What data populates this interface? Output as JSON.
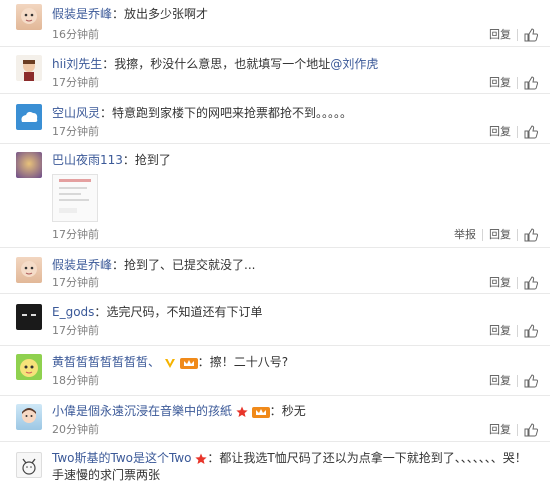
{
  "comments": [
    {
      "user": "假装是乔峰",
      "sep": "：",
      "text": "放出多少张啊才",
      "time": "16分钟前",
      "reply": "回复"
    },
    {
      "user": "hii刘先生",
      "sep": "：",
      "text": "我擦，秒没什么意思，也就填写一个地址",
      "mention": "@刘作虎",
      "time": "17分钟前",
      "reply": "回复"
    },
    {
      "user": "空山风灵",
      "sep": "：",
      "text": "特意跑到家楼下的网吧来抢票都抢不到。。。。。",
      "time": "17分钟前",
      "reply": "回复"
    },
    {
      "user": "巴山夜雨113",
      "sep": "：",
      "text": "抢到了",
      "time": "17分钟前",
      "report": "举报",
      "reply": "回复"
    },
    {
      "user": "假装是乔峰",
      "sep": "：",
      "text": "抢到了、已提交就没了...",
      "time": "17分钟前",
      "reply": "回复"
    },
    {
      "user": "E_gods",
      "sep": "：",
      "text": "选完尺码，不知道还有下订单",
      "time": "17分钟前",
      "reply": "回复"
    },
    {
      "user": "黄皙皙皙皙皙皙皙、",
      "sep": "：",
      "text": "擦！二十八号?",
      "time": "18分钟前",
      "reply": "回复"
    },
    {
      "user": "小偉是個永遠沉浸在音樂中的孩紙",
      "sep": "：",
      "text": "秒无",
      "time": "20分钟前",
      "reply": "回复"
    },
    {
      "user": "Two斯基的Two是这个Two",
      "sep": "：",
      "text": "都让我选T恤尺码了还以为点拿一下就抢到了、、、、、、、哭！手速慢的求门票两张"
    }
  ],
  "icons": {
    "like": "thumbs-up-icon",
    "vip": "vip-v-icon",
    "star": "star-badge-icon",
    "crown": "member-crown-icon"
  },
  "colors": {
    "link": "#3b5998",
    "time": "#808080",
    "divider": "#e9e9e9",
    "star": "#e8352a",
    "vip": "#f5b300"
  }
}
